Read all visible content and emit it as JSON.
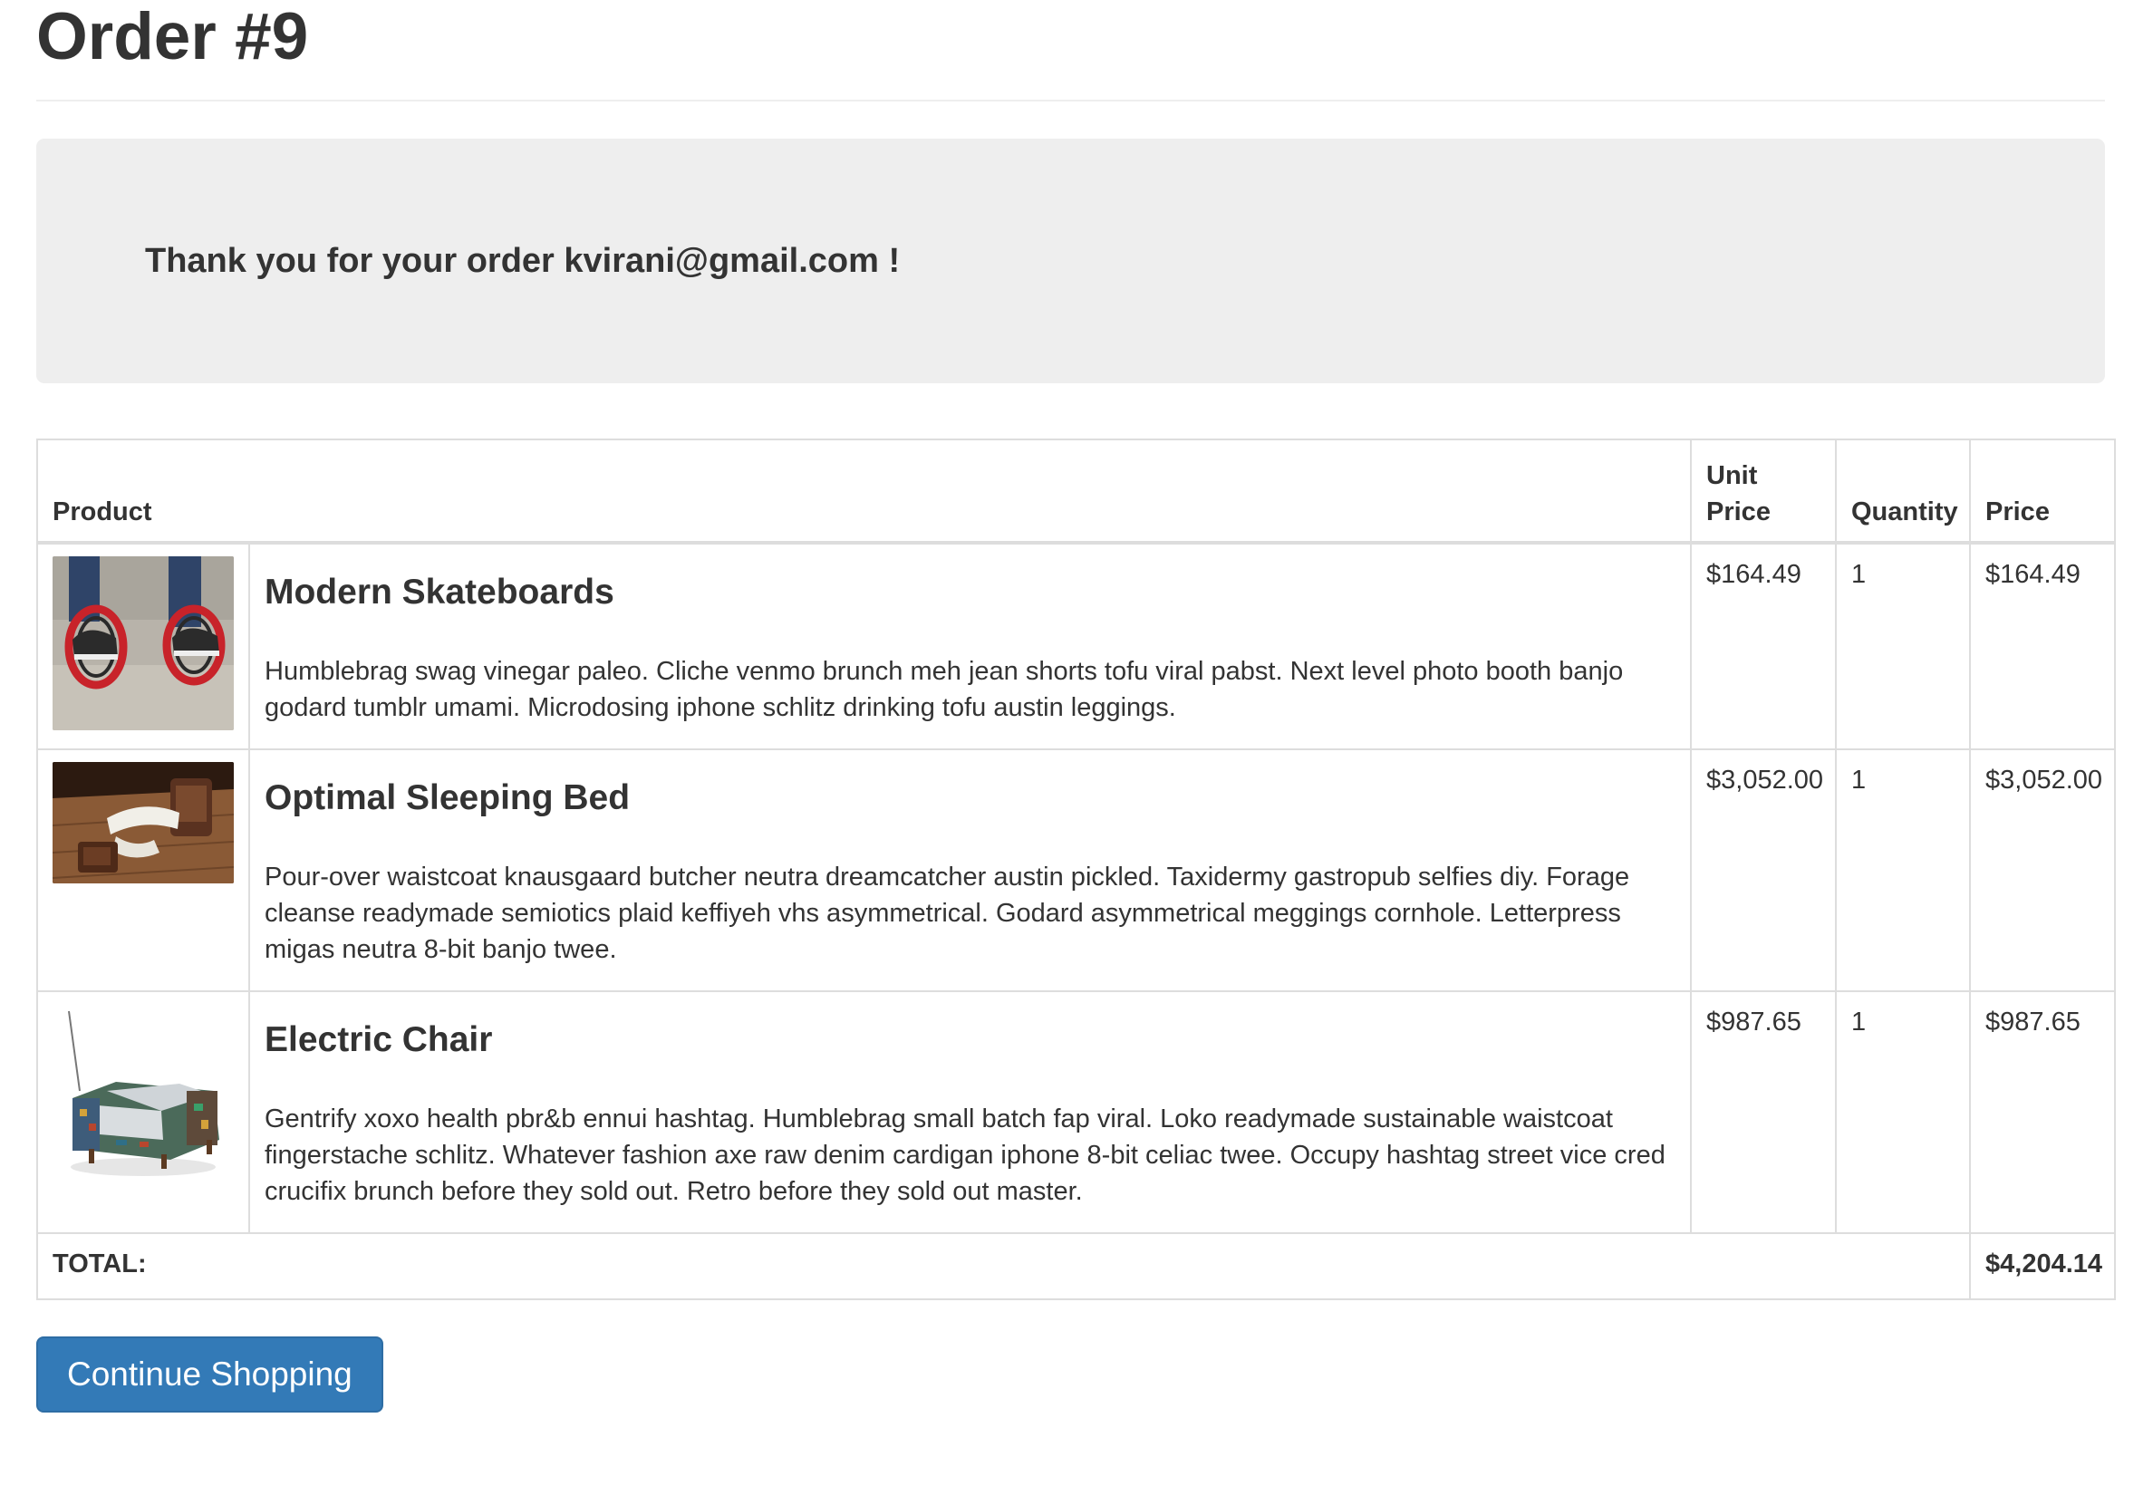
{
  "page": {
    "title": "Order #9"
  },
  "jumbotron": {
    "message": "Thank you for your order kvirani@gmail.com !"
  },
  "table": {
    "headers": {
      "product": "Product",
      "unit_price": "Unit Price",
      "quantity": "Quantity",
      "price": "Price"
    },
    "items": [
      {
        "name": "Modern Skateboards",
        "description": "Humblebrag swag vinegar paleo. Cliche venmo brunch meh jean shorts tofu viral pabst. Next level photo booth banjo godard tumblr umami. Microdosing iphone schlitz drinking tofu austin leggings.",
        "unit_price": "$164.49",
        "quantity": "1",
        "price": "$164.49",
        "image_icon": "skateboard-product-image"
      },
      {
        "name": "Optimal Sleeping Bed",
        "description": "Pour-over waistcoat knausgaard butcher neutra dreamcatcher austin pickled. Taxidermy gastropub selfies diy. Forage cleanse readymade semiotics plaid keffiyeh vhs asymmetrical. Godard asymmetrical meggings cornhole. Letterpress migas neutra 8-bit banjo twee.",
        "unit_price": "$3,052.00",
        "quantity": "1",
        "price": "$3,052.00",
        "image_icon": "bed-product-image"
      },
      {
        "name": "Electric Chair",
        "description": "Gentrify xoxo health pbr&b ennui hashtag. Humblebrag small batch fap viral. Loko readymade sustainable waistcoat fingerstache schlitz. Whatever fashion axe raw denim cardigan iphone 8-bit celiac twee. Occupy hashtag street vice cred crucifix brunch before they sold out. Retro before they sold out master.",
        "unit_price": "$987.65",
        "quantity": "1",
        "price": "$987.65",
        "image_icon": "chair-product-image"
      }
    ],
    "total": {
      "label": "TOTAL:",
      "value": "$4,204.14"
    }
  },
  "actions": {
    "continue_label": "Continue Shopping"
  },
  "colors": {
    "primary_button": "#337ab7",
    "jumbotron_bg": "#eeeeee",
    "table_border": "#dddddd",
    "text": "#333333"
  }
}
